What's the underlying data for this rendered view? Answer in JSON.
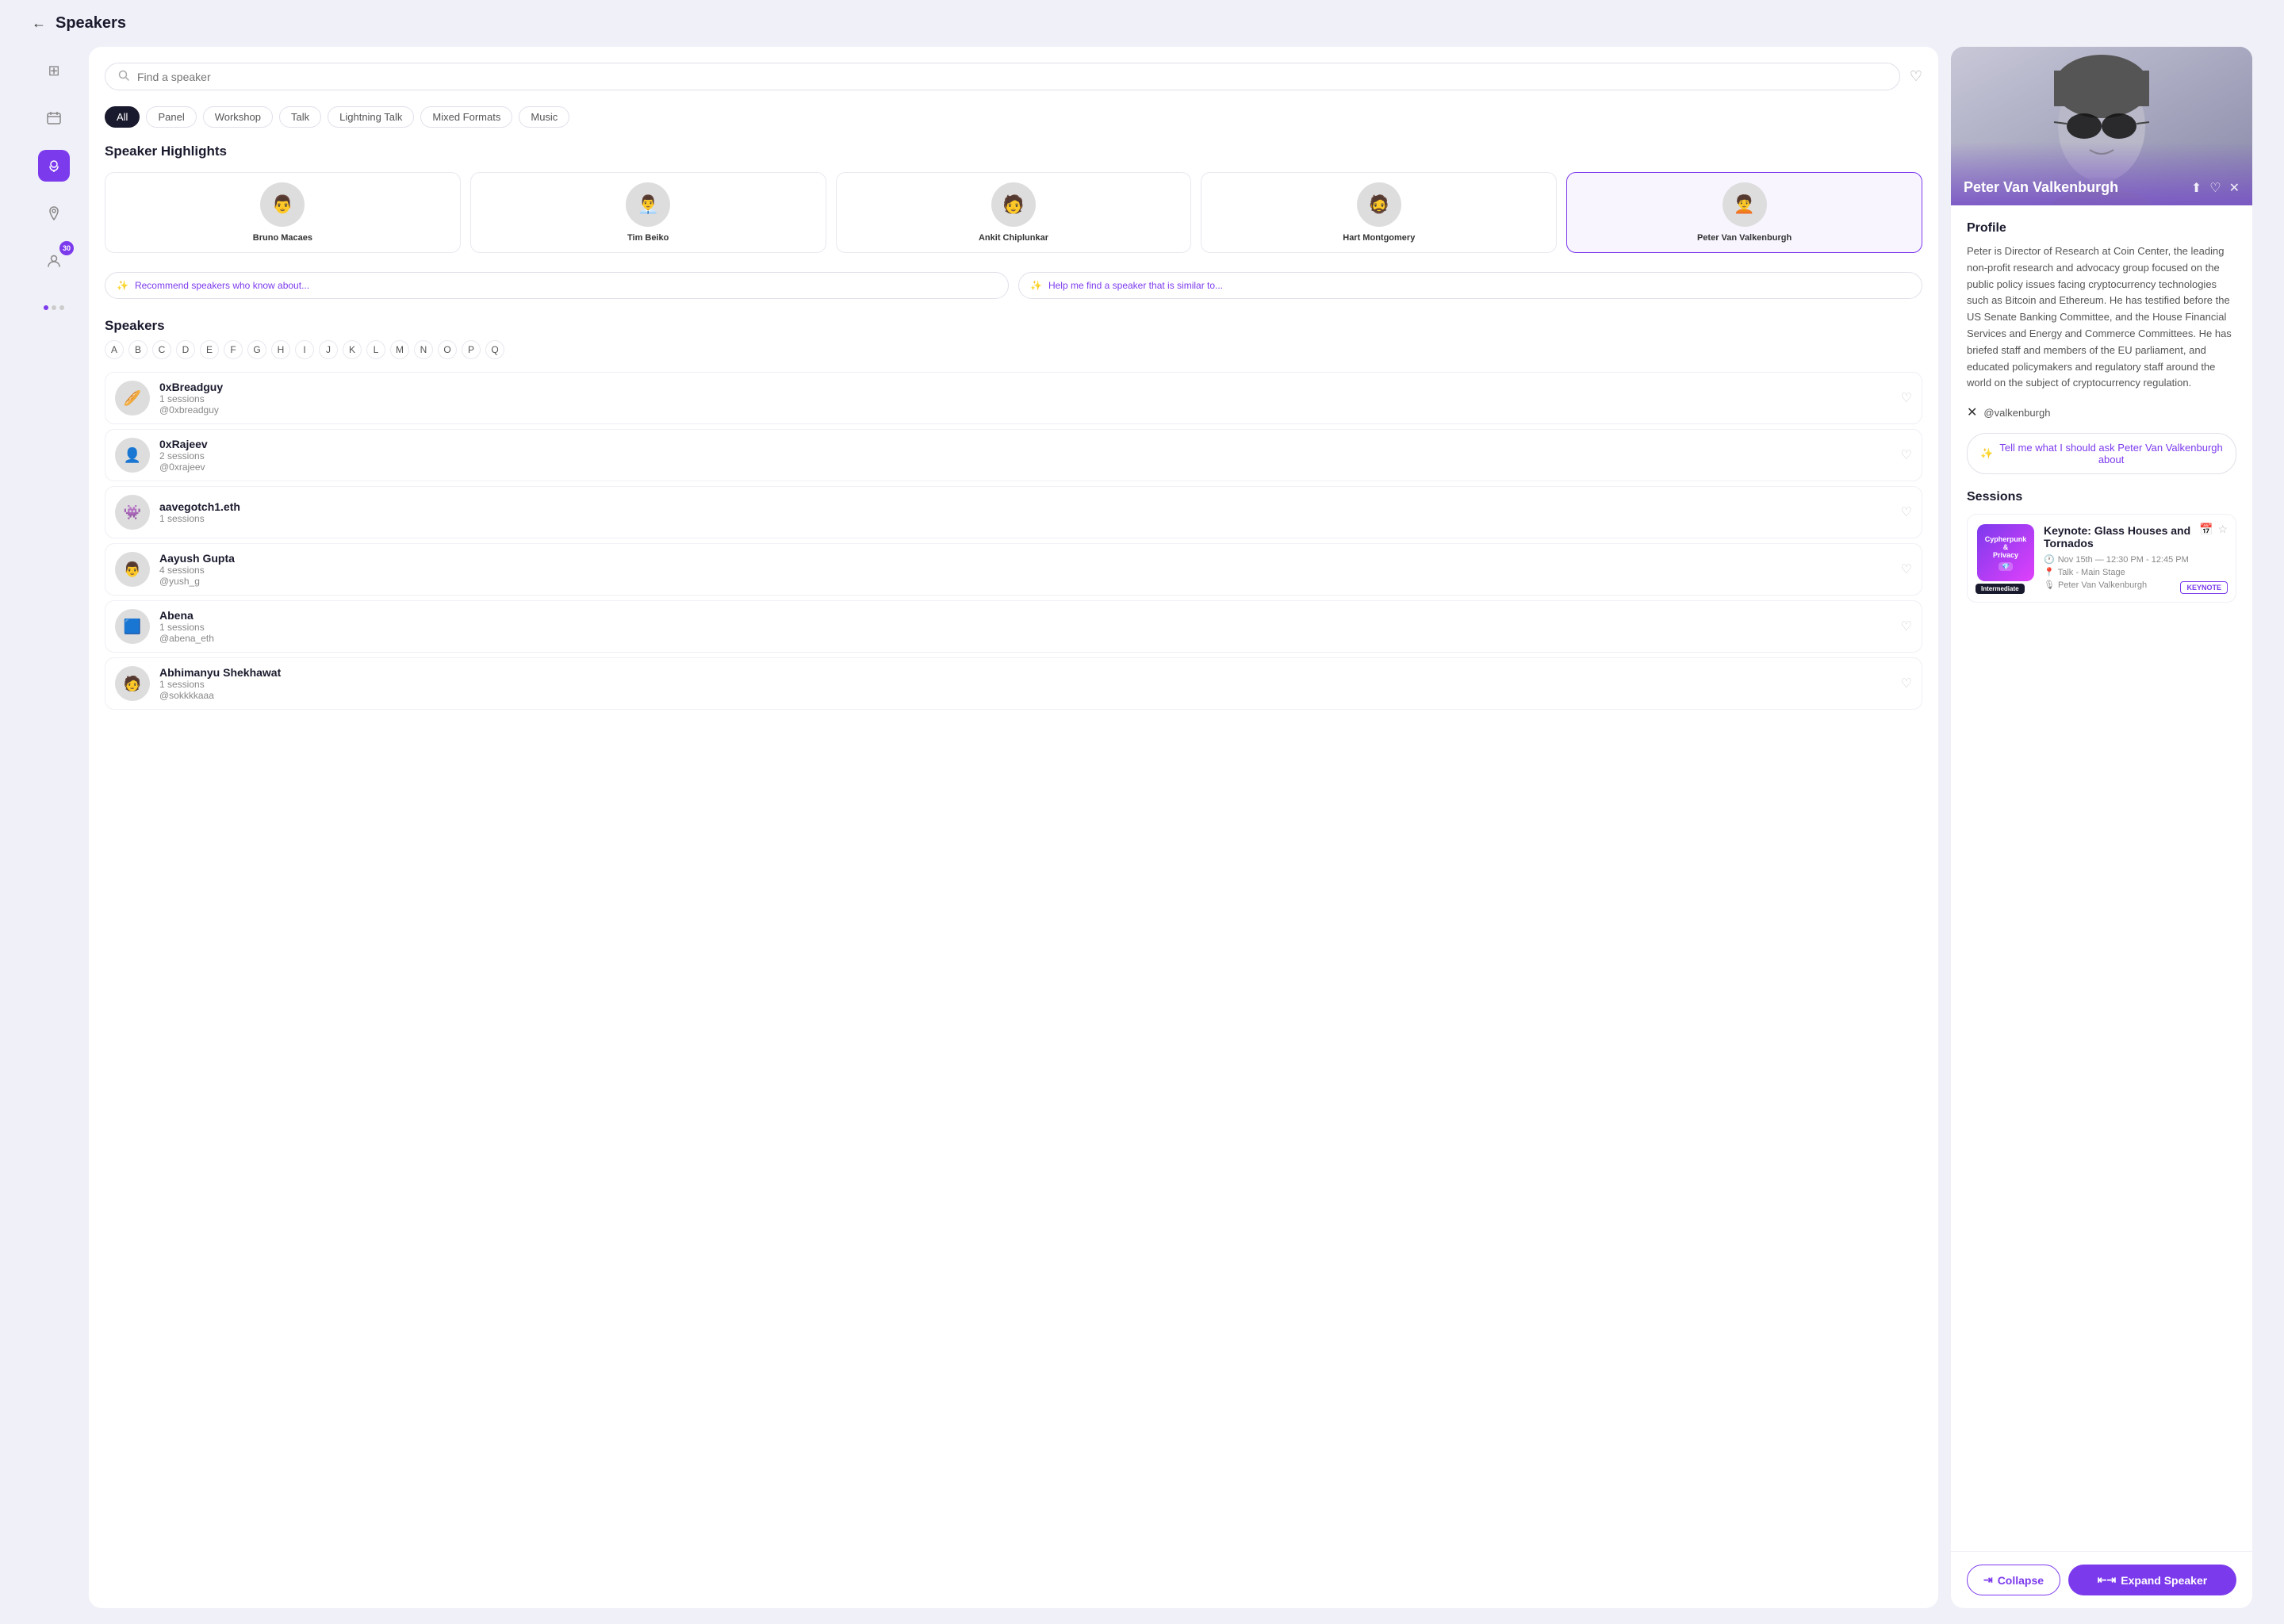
{
  "header": {
    "back_label": "←",
    "title": "Speakers"
  },
  "sidebar": {
    "icons": [
      {
        "name": "grid-icon",
        "symbol": "⊞",
        "active": false
      },
      {
        "name": "calendar-icon",
        "symbol": "📅",
        "active": false
      },
      {
        "name": "mic-icon",
        "symbol": "🎙",
        "active": true
      },
      {
        "name": "location-icon",
        "symbol": "📍",
        "active": false
      },
      {
        "name": "person-icon",
        "symbol": "👤",
        "active": false
      }
    ],
    "badge": "30",
    "dots": [
      "active",
      "inactive",
      "inactive"
    ]
  },
  "search": {
    "placeholder": "Find a speaker"
  },
  "filters": [
    {
      "label": "All",
      "active": true
    },
    {
      "label": "Panel",
      "active": false
    },
    {
      "label": "Workshop",
      "active": false
    },
    {
      "label": "Talk",
      "active": false
    },
    {
      "label": "Lightning Talk",
      "active": false
    },
    {
      "label": "Mixed Formats",
      "active": false
    },
    {
      "label": "Music",
      "active": false
    }
  ],
  "highlights_section": {
    "title": "Speaker Highlights",
    "speakers": [
      {
        "name": "Bruno Macaes",
        "emoji": "👨"
      },
      {
        "name": "Tim Beiko",
        "emoji": "👨‍💼"
      },
      {
        "name": "Ankit Chiplunkar",
        "emoji": "🧑"
      },
      {
        "name": "Hart Montgomery",
        "emoji": "🧔"
      },
      {
        "name": "Peter Van Valkenburgh",
        "emoji": "🧑‍🦱",
        "selected": true
      }
    ]
  },
  "ai_buttons": [
    {
      "label": "Recommend speakers who know about...",
      "icon": "✨"
    },
    {
      "label": "Help me find a speaker that is similar to...",
      "icon": "✨"
    }
  ],
  "speakers_section": {
    "title": "Speakers",
    "alpha": [
      "A",
      "B",
      "C",
      "D",
      "E",
      "F",
      "G",
      "H",
      "I",
      "J",
      "K",
      "L",
      "M",
      "N",
      "O",
      "P",
      "Q"
    ],
    "list": [
      {
        "name": "0xBreadguy",
        "sessions": "1 sessions",
        "handle": "@0xbreadguy",
        "emoji": "🥖"
      },
      {
        "name": "0xRajeev",
        "sessions": "2 sessions",
        "handle": "@0xrajeev",
        "emoji": "👤"
      },
      {
        "name": "aavegotch1.eth",
        "sessions": "1 sessions",
        "handle": "",
        "emoji": "👾"
      },
      {
        "name": "Aayush Gupta",
        "sessions": "4 sessions",
        "handle": "@yush_g",
        "emoji": "👨"
      },
      {
        "name": "Abena",
        "sessions": "1 sessions",
        "handle": "@abena_eth",
        "emoji": "🟦"
      },
      {
        "name": "Abhimanyu Shekhawat",
        "sessions": "1 sessions",
        "handle": "@sokkkkaaa",
        "emoji": "🧑"
      }
    ]
  },
  "right_panel": {
    "speaker_name": "Peter Van Valkenburgh",
    "social_handle": "@valkenburgh",
    "profile_heading": "Profile",
    "bio": "Peter is Director of Research at Coin Center, the leading non-profit research and advocacy group focused on the public policy issues facing cryptocurrency technologies such as Bitcoin and Ethereum. He has testified before the US Senate Banking Committee, and the House Financial Services and Energy and Commerce Committees. He has briefed staff and members of the EU parliament, and educated policymakers and regulatory staff around the world on the subject of cryptocurrency regulation.",
    "ai_ask_placeholder": "Tell me what I should ask Peter Van Valkenburgh about",
    "sessions_heading": "Sessions",
    "session": {
      "thumb_line1": "Cypherpunk &",
      "thumb_line2": "Privacy",
      "title": "Keynote: Glass Houses and Tornados",
      "date": "Nov 15th — 12:30 PM - 12:45 PM",
      "type": "Talk - Main Stage",
      "speaker": "Peter Van Valkenburgh",
      "level": "Intermediate",
      "tag": "KEYNOTE"
    },
    "collapse_label": "Collapse",
    "expand_label": "Expand Speaker"
  }
}
